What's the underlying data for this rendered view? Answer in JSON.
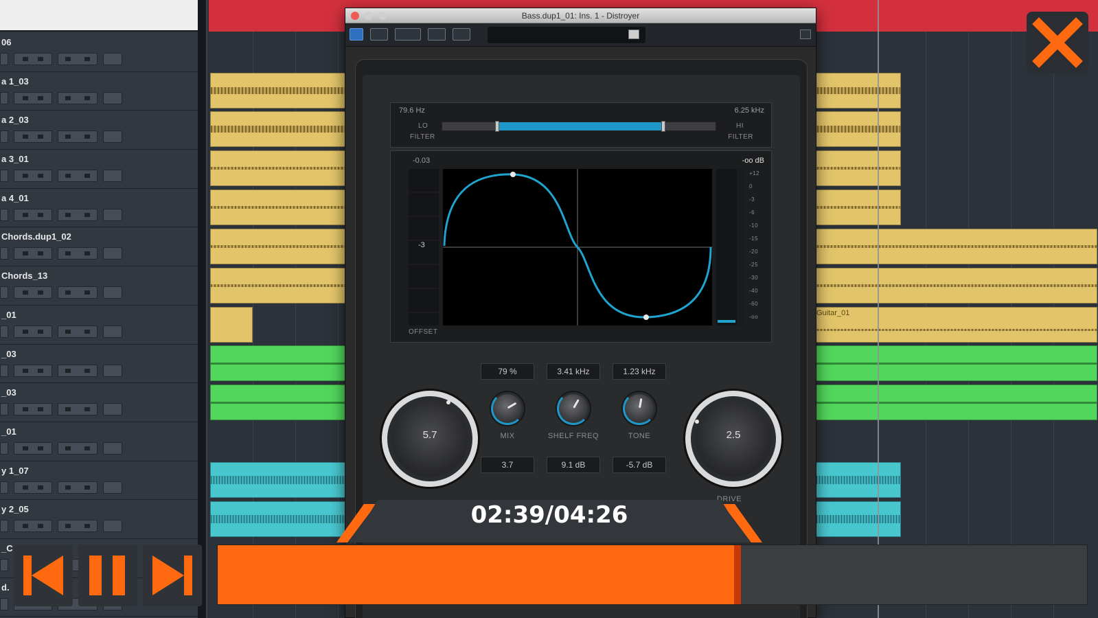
{
  "track_list": {
    "tracks": [
      {
        "name": "06"
      },
      {
        "name": "a 1_03"
      },
      {
        "name": "a 2_03"
      },
      {
        "name": "a 3_01"
      },
      {
        "name": "a 4_01"
      },
      {
        "name": "Chords.dup1_02"
      },
      {
        "name": "Chords_13"
      },
      {
        "name": "_01"
      },
      {
        "name": "_03"
      },
      {
        "name": "_03"
      },
      {
        "name": "_01"
      },
      {
        "name": "y 1_07"
      },
      {
        "name": "y 2_05"
      },
      {
        "name": "_C"
      },
      {
        "name": "d."
      }
    ]
  },
  "arrange": {
    "clip_label": "Guitar_01"
  },
  "plugin": {
    "window_title": "Bass.dup1_01: Ins. 1 - Distroyer",
    "filter": {
      "lo_value": "79.6 Hz",
      "hi_value": "6.25 kHz",
      "lo_label_1": "LO",
      "lo_label_2": "FILTER",
      "hi_label_1": "HI",
      "hi_label_2": "FILTER",
      "range_start": 0.2,
      "range_end": 0.81
    },
    "display": {
      "offset_value": "-0.03",
      "output_value": "-oo dB",
      "offset_label": "OFFSET",
      "meter_scale": [
        "+12",
        "0",
        "-3",
        "-6",
        "-10",
        "-15",
        "-20",
        "-25",
        "-30",
        "-40",
        "-60",
        "-oo"
      ]
    },
    "controls": {
      "mix_value": "79 %",
      "mix_label": "MIX",
      "shelf_freq_value": "3.41 kHz",
      "shelf_freq_label": "SHELF FREQ",
      "tone_value": "1.23 kHz",
      "tone_label": "TONE",
      "left_big_value": "5.7",
      "right_big_value": "2.5",
      "row2_left": "3.7",
      "row2_mid": "9.1 dB",
      "row2_right": "-5.7 dB",
      "drive_label": "DRIVE"
    }
  },
  "player": {
    "timecode": "02:39/04:26",
    "progress": 0.6,
    "accent_color": "#ff6a10"
  }
}
